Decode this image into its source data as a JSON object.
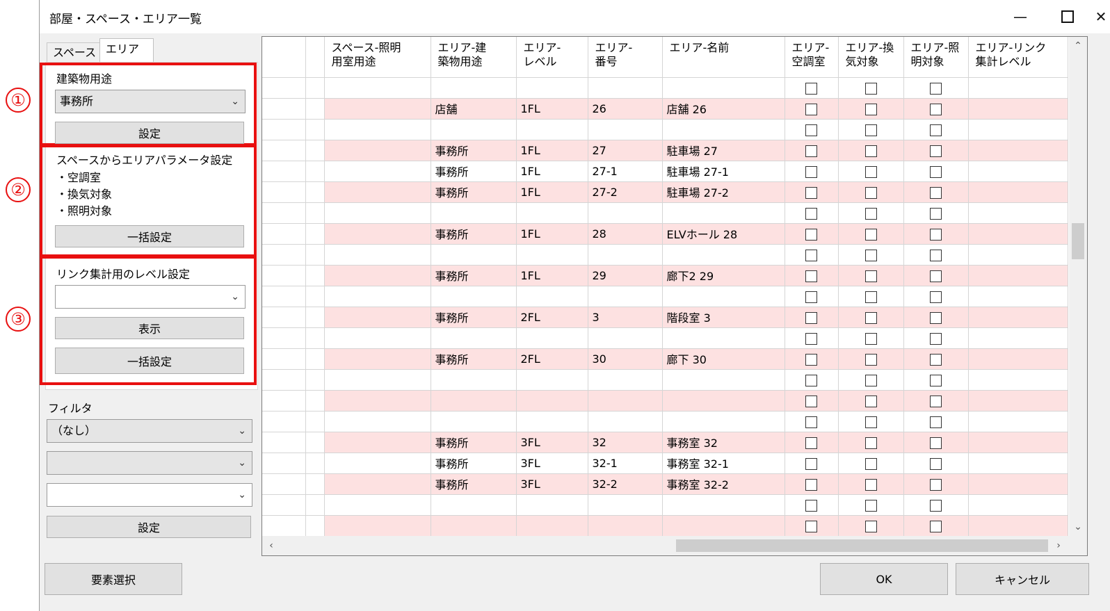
{
  "window": {
    "title": "部屋・スペース・エリア一覧",
    "minimize": "—",
    "close": "✕"
  },
  "tabs": [
    "スペース",
    "エリア"
  ],
  "section1": {
    "label": "建築物用途",
    "select_value": "事務所",
    "button": "設定",
    "marker": "①"
  },
  "section2": {
    "label": "スペースからエリアパラメータ設定",
    "items": [
      "・空調室",
      "・換気対象",
      "・照明対象"
    ],
    "button": "一括設定",
    "marker": "②"
  },
  "section3": {
    "label": "リンク集計用のレベル設定",
    "select_value": "",
    "button_show": "表示",
    "button_bulk": "一括設定",
    "marker": "③"
  },
  "filter": {
    "label": "フィルタ",
    "select1": "（なし）",
    "select2": "",
    "select3": "",
    "button": "設定"
  },
  "bottom": {
    "select_elements": "要素選択",
    "ok": "OK",
    "cancel": "キャンセル"
  },
  "table": {
    "columns": [
      "",
      "",
      "スペース-照明\n用室用途",
      "エリア-建\n築物用途",
      "エリア-\nレベル",
      "エリア-\n番号",
      "エリア-名前",
      "エリア-\n空調室",
      "エリア-換\n気対象",
      "エリア-照\n明対象",
      "エリア-リンク\n集計レベル"
    ],
    "rows": [
      {
        "pink": false,
        "usage": "",
        "level": "",
        "number": "",
        "name": ""
      },
      {
        "pink": true,
        "usage": "店舗",
        "level": "1FL",
        "number": "26",
        "name": "店舗 26"
      },
      {
        "pink": false,
        "usage": "",
        "level": "",
        "number": "",
        "name": ""
      },
      {
        "pink": true,
        "usage": "事務所",
        "level": "1FL",
        "number": "27",
        "name": "駐車場 27"
      },
      {
        "pink": false,
        "usage": "事務所",
        "level": "1FL",
        "number": "27-1",
        "name": "駐車場 27-1"
      },
      {
        "pink": true,
        "usage": "事務所",
        "level": "1FL",
        "number": "27-2",
        "name": "駐車場 27-2"
      },
      {
        "pink": false,
        "usage": "",
        "level": "",
        "number": "",
        "name": ""
      },
      {
        "pink": true,
        "usage": "事務所",
        "level": "1FL",
        "number": "28",
        "name": "ELVホール 28"
      },
      {
        "pink": false,
        "usage": "",
        "level": "",
        "number": "",
        "name": ""
      },
      {
        "pink": true,
        "usage": "事務所",
        "level": "1FL",
        "number": "29",
        "name": "廊下2 29"
      },
      {
        "pink": false,
        "usage": "",
        "level": "",
        "number": "",
        "name": ""
      },
      {
        "pink": true,
        "usage": "事務所",
        "level": "2FL",
        "number": "3",
        "name": "階段室 3"
      },
      {
        "pink": false,
        "usage": "",
        "level": "",
        "number": "",
        "name": ""
      },
      {
        "pink": true,
        "usage": "事務所",
        "level": "2FL",
        "number": "30",
        "name": "廊下 30"
      },
      {
        "pink": false,
        "usage": "",
        "level": "",
        "number": "",
        "name": ""
      },
      {
        "pink": true,
        "usage": "",
        "level": "",
        "number": "",
        "name": ""
      },
      {
        "pink": false,
        "usage": "",
        "level": "",
        "number": "",
        "name": ""
      },
      {
        "pink": true,
        "usage": "事務所",
        "level": "3FL",
        "number": "32",
        "name": "事務室 32"
      },
      {
        "pink": false,
        "usage": "事務所",
        "level": "3FL",
        "number": "32-1",
        "name": "事務室 32-1"
      },
      {
        "pink": true,
        "usage": "事務所",
        "level": "3FL",
        "number": "32-2",
        "name": "事務室 32-2"
      },
      {
        "pink": false,
        "usage": "",
        "level": "",
        "number": "",
        "name": ""
      },
      {
        "pink": true,
        "usage": "",
        "level": "",
        "number": "",
        "name": ""
      }
    ]
  },
  "colors": {
    "pink_row": "#fde1e1",
    "annotation_red": "#e81010"
  }
}
